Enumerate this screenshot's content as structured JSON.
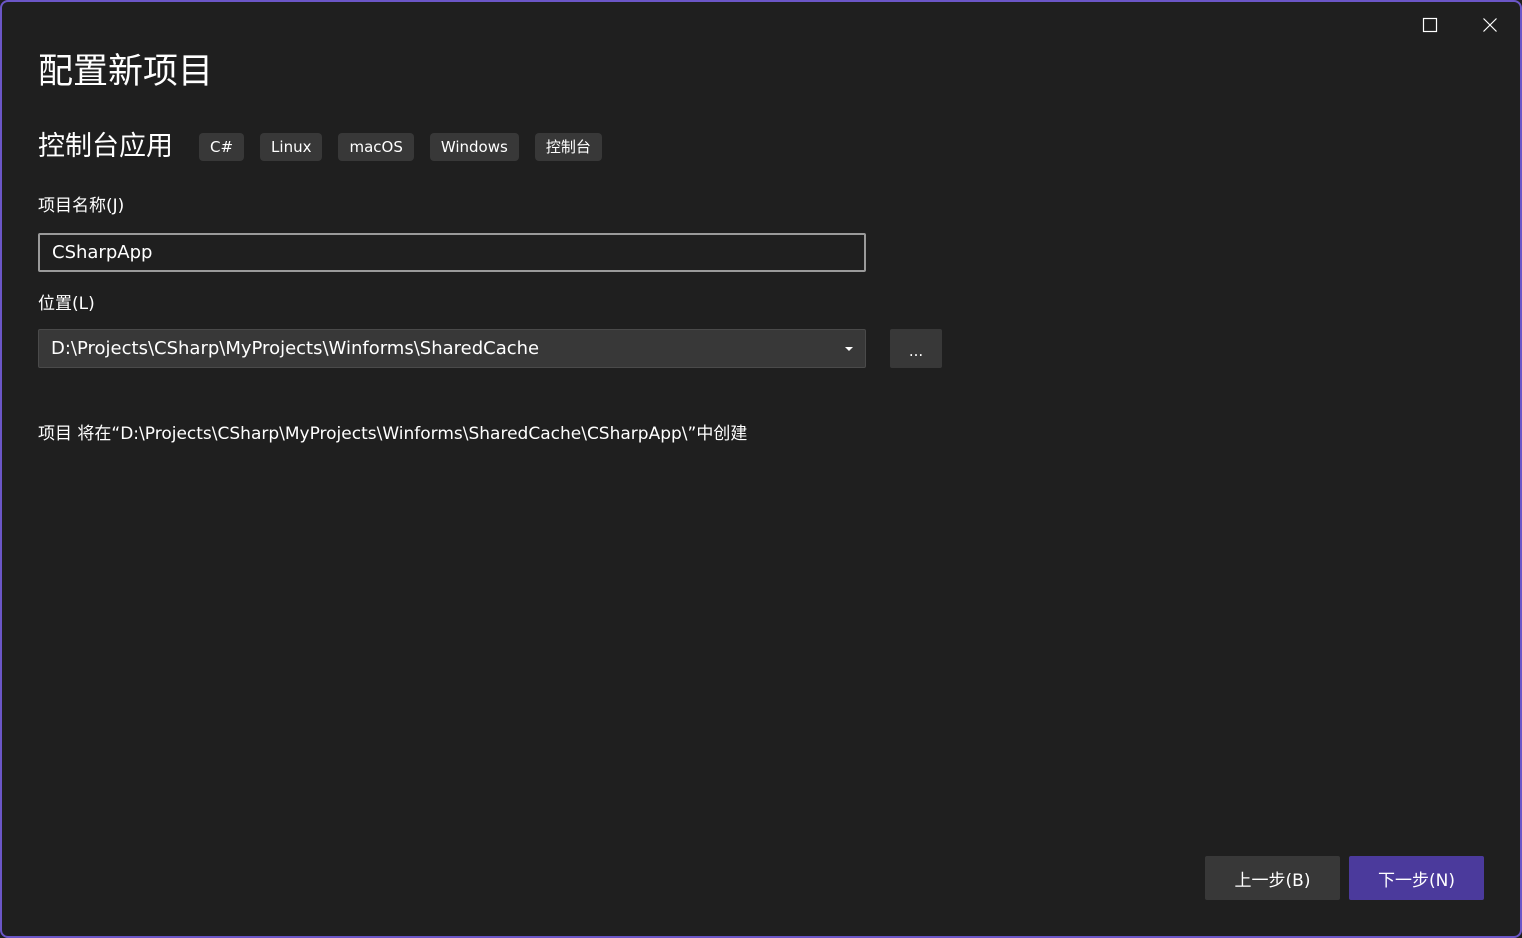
{
  "header": {
    "title": "配置新项目"
  },
  "window_controls": {
    "maximize_icon": "maximize-icon",
    "close_icon": "close-icon"
  },
  "template": {
    "name": "控制台应用",
    "tags": [
      "C#",
      "Linux",
      "macOS",
      "Windows",
      "控制台"
    ]
  },
  "form": {
    "project_name_label": "项目名称(J)",
    "project_name_value": "CSharpApp",
    "location_label": "位置(L)",
    "location_value": "D:\\Projects\\CSharp\\MyProjects\\Winforms\\SharedCache",
    "browse_label": "...",
    "path_info": "项目 将在“D:\\Projects\\CSharp\\MyProjects\\Winforms\\SharedCache\\CSharpApp\\”中创建"
  },
  "footer": {
    "back_label": "上一步(B)",
    "next_label": "下一步(N)"
  },
  "colors": {
    "background": "#1f1f1f",
    "accent": "#4b3a9c",
    "window_border": "#6b56c7",
    "control_bg": "#383838"
  }
}
